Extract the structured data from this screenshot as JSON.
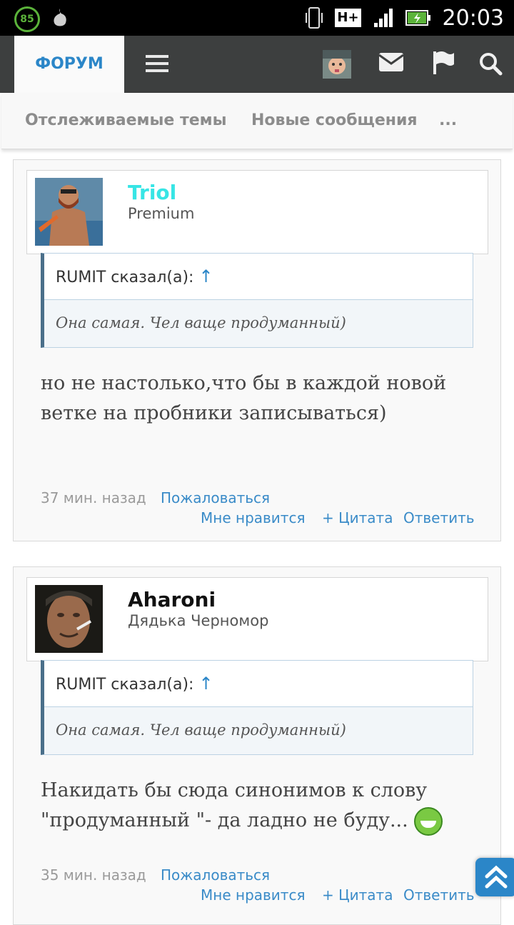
{
  "status_bar": {
    "battery_percent": "85",
    "network": "H+",
    "time": "20:03"
  },
  "header": {
    "forum_tab": "ФОРУМ",
    "icons": [
      "menu-icon",
      "user-avatar",
      "mail-icon",
      "flag-icon",
      "search-icon"
    ]
  },
  "subnav": {
    "items": [
      "Отслеживаемые темы",
      "Новые сообщения",
      "..."
    ]
  },
  "posts": [
    {
      "username": "Triol",
      "username_color": "#37e5e5",
      "user_title": "Premium",
      "quote_author": "RUMIT сказал(а):",
      "quote_arrow": "↑",
      "quote_text": "Она самая. Чел ваще продуманный)",
      "message": "но не настолько,что бы в каждой новой ветке на пробники записываться)",
      "time": "37 мин. назад",
      "report": "Пожаловаться",
      "like": "Мне нравится",
      "quote_action": "+ Цитата",
      "reply": "Ответить"
    },
    {
      "username": "Aharoni",
      "username_color": "#111111",
      "user_title": "Дядька Черномор",
      "quote_author": "RUMIT сказал(а):",
      "quote_arrow": "↑",
      "quote_text": "Она самая. Чел ваще продуманный)",
      "message": "Накидать бы сюда синонимов к слову \"продуманный \"- да ладно не буду...",
      "time": "35 мин. назад",
      "report": "Пожаловаться",
      "like": "Мне нравится",
      "quote_action": "+ Цитата",
      "reply": "Ответить"
    }
  ],
  "colors": {
    "header_bg": "#3d3f3f",
    "accent": "#2b86c8",
    "link": "#3a8bc8"
  }
}
